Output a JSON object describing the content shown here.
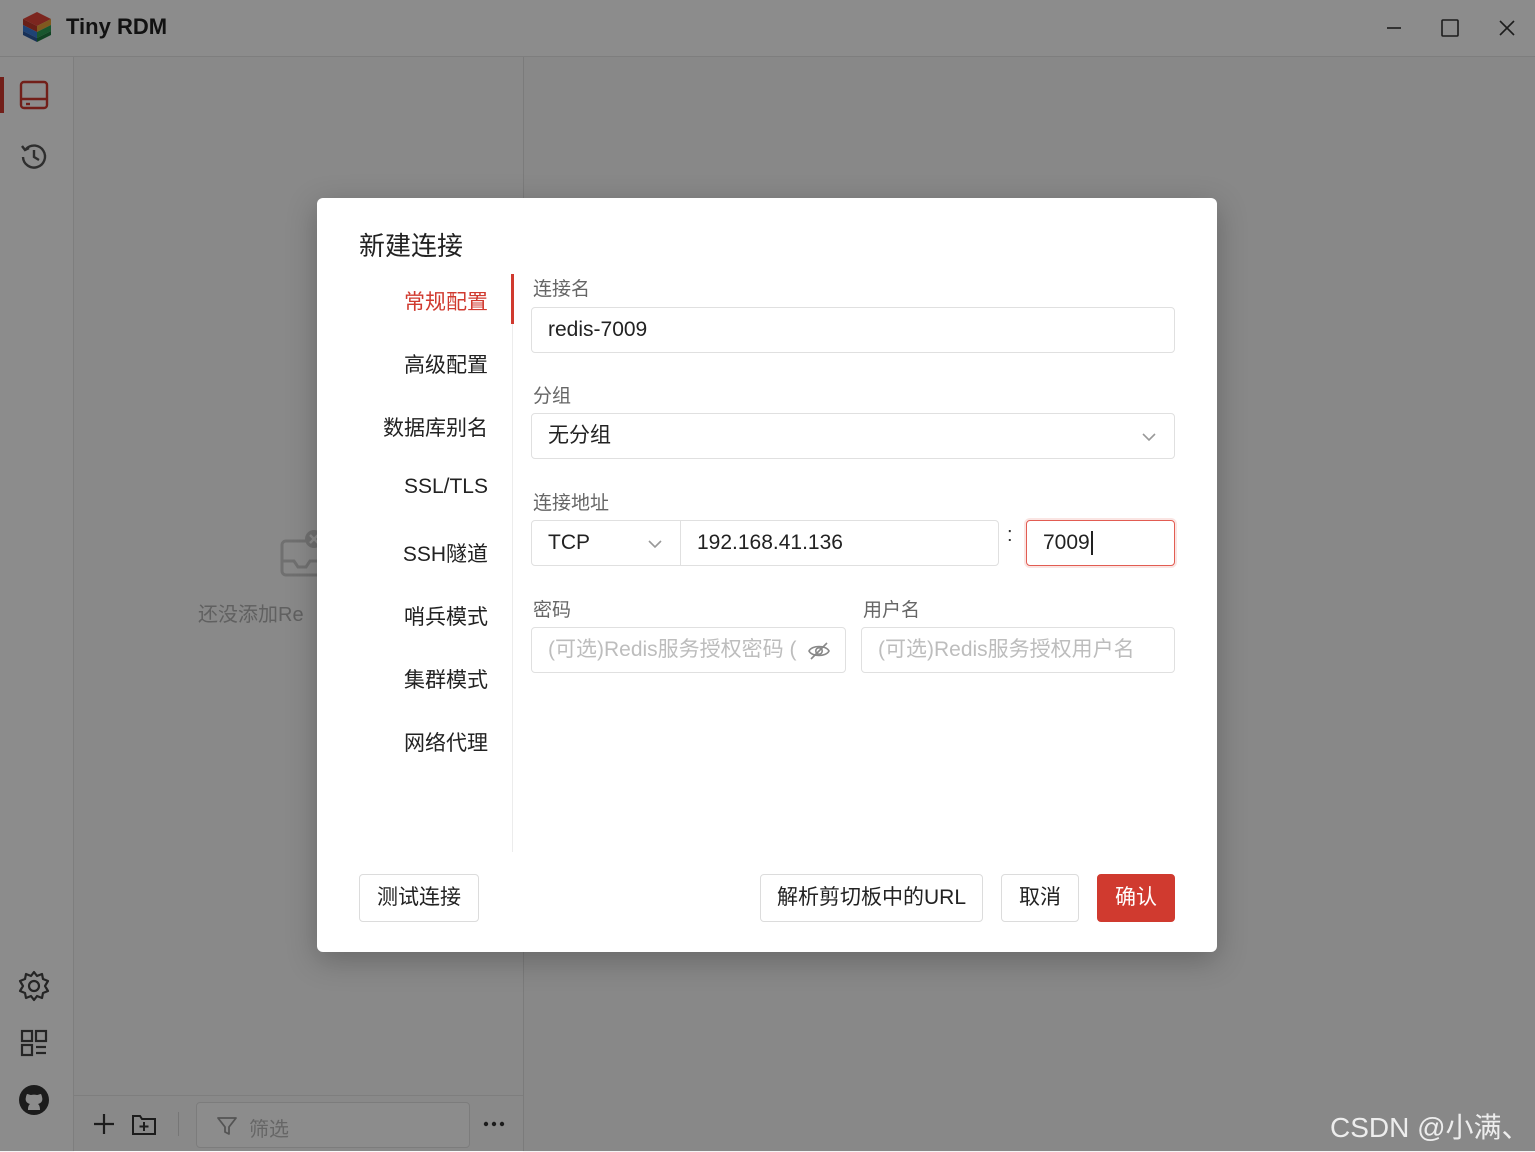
{
  "app": {
    "title": "Tiny RDM"
  },
  "sidebar": {
    "items": [
      {
        "icon": "server-icon",
        "active": true
      },
      {
        "icon": "history-icon"
      }
    ],
    "bottom_items": [
      {
        "icon": "gear-icon"
      },
      {
        "icon": "grid-icon"
      },
      {
        "icon": "github-icon"
      }
    ]
  },
  "connections": {
    "empty_text": "还没添加Re",
    "filter_placeholder": "筛选"
  },
  "dialog": {
    "title": "新建连接",
    "tabs": [
      {
        "label": "常规配置",
        "active": true
      },
      {
        "label": "高级配置"
      },
      {
        "label": "数据库别名"
      },
      {
        "label": "SSL/TLS"
      },
      {
        "label": "SSH隧道"
      },
      {
        "label": "哨兵模式"
      },
      {
        "label": "集群模式"
      },
      {
        "label": "网络代理"
      }
    ],
    "form": {
      "name_label": "连接名",
      "name_value": "redis-7009",
      "group_label": "分组",
      "group_value": "无分组",
      "address_label": "连接地址",
      "protocol_value": "TCP",
      "host_value": "192.168.41.136",
      "colon": ":",
      "port_value": "7009",
      "password_label": "密码",
      "password_placeholder": "(可选)Redis服务授权密码 (",
      "username_label": "用户名",
      "username_placeholder": "(可选)Redis服务授权用户名"
    },
    "buttons": {
      "test": "测试连接",
      "parse_url": "解析剪切板中的URL",
      "cancel": "取消",
      "confirm": "确认"
    }
  },
  "watermark": "CSDN @小满、",
  "colors": {
    "accent": "#d03a2f"
  }
}
